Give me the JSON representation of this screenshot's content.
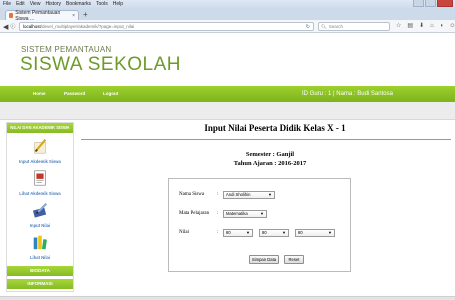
{
  "browser": {
    "menu": [
      "File",
      "Edit",
      "View",
      "History",
      "Bookmarks",
      "Tools",
      "Help"
    ],
    "tab_title": "Sistem Pemantauan Siswa ...",
    "tab_close": "×",
    "new_tab": "+",
    "url_host": "localhost",
    "url_path": "/devel_multiplayer/akademik/?page=input_nilai",
    "search_placeholder": "Search"
  },
  "header": {
    "subtitle": "SISTEM PEMANTAUAN",
    "title": "SISWA SEKOLAH"
  },
  "topnav": {
    "links": [
      "Home",
      "Password",
      "Logout"
    ],
    "user_info": "ID Guru : 1 | Nama : Budi Santosa"
  },
  "sidebar": {
    "heading": "NILAI DAN AKADEMIK SISWA",
    "items": [
      {
        "label": "Input Akdemik Siswa",
        "icon": "pencil-paper-icon"
      },
      {
        "label": "Lihat Akdemik Siswa",
        "icon": "document-icon"
      },
      {
        "label": "Input Nilai",
        "icon": "pen-book-icon"
      },
      {
        "label": "Lihat Nilai",
        "icon": "books-icon"
      }
    ],
    "sections": [
      "BIODATA",
      "INFORMASI"
    ]
  },
  "main": {
    "title": "Input Nilai Peserta Didik Kelas X - 1",
    "semester": "Semester : Ganjil",
    "tahun_ajaran": "Tahun Ajaran : 2016-2017",
    "form": {
      "nama_label": "Nama Siswa",
      "nama_value": "Andi Sholihin",
      "mapel_label": "Mata Pelajaran",
      "mapel_value": "Matematika",
      "nilai_label": "Nilai",
      "nilai_values": [
        "80",
        "80",
        "80"
      ],
      "colon": ":",
      "save_button": "Simpan Data",
      "reset_button": "Reset"
    }
  },
  "colors": {
    "accent_green": "#7cb21e",
    "title_green": "#6f9a2a",
    "link_blue": "#4a7fc1"
  }
}
